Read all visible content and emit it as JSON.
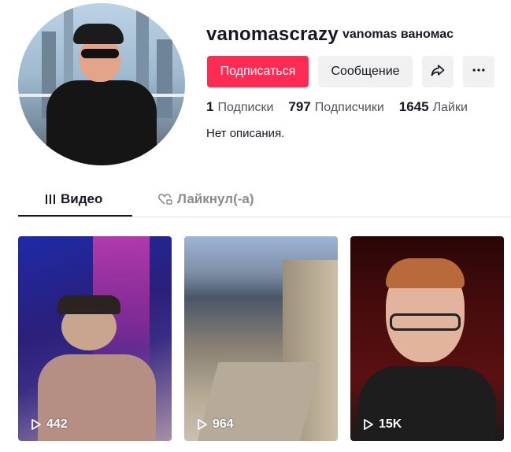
{
  "profile": {
    "username": "vanomascrazy",
    "nickname": "vanomas ваномас",
    "bio": "Нет описания."
  },
  "actions": {
    "follow_label": "Подписаться",
    "message_label": "Сообщение",
    "share_icon": "share-icon",
    "more_icon": "more-icon",
    "follow_color": "#fe2c55"
  },
  "stats": {
    "following": {
      "value": "1",
      "label": "Подписки"
    },
    "followers": {
      "value": "797",
      "label": "Подписчики"
    },
    "likes": {
      "value": "1645",
      "label": "Лайки"
    }
  },
  "tabs": [
    {
      "label": "Видео",
      "icon": "grid-icon",
      "active": true
    },
    {
      "label": "Лайкнул(-а)",
      "icon": "heart-lock-icon",
      "active": false
    }
  ],
  "videos": [
    {
      "views": "442"
    },
    {
      "views": "964"
    },
    {
      "views": "15K"
    }
  ]
}
